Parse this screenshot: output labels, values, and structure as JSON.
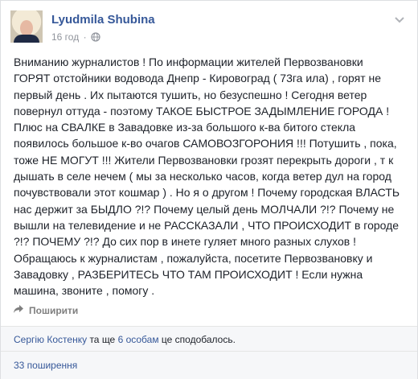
{
  "post": {
    "author": "Lyudmila Shubina",
    "time": "16 год",
    "separator": "·",
    "lines": [
      "Вниманию журналистов ! По информации жителей Первозвановки",
      "ГОРЯТ отстойники водовода Днепр - Кировоград ( 73га ила) , горят не",
      "первый день . Их пытаются тушить, но безуспешно ! Сегодня ветер",
      "повернул оттуда - поэтому ТАКОЕ БЫСТРОЕ ЗАДЫМЛЕНИЕ ГОРОДА !",
      "Плюс на СВАЛКЕ в Завадовке из-за большого к-ва битого стекла",
      "появилось большое к-во очагов САМОВОЗГОРОНИЯ !!! Потушить , пока,",
      "тоже НЕ МОГУТ !!! Жители Первозвановки грозят перекрыть дороги , т к",
      "дышать в селе нечем ( мы за несколько часов, когда ветер дул на город",
      "почувствовали этот кошмар ) . Но я о другом ! Почему городская ВЛАСТЬ",
      "нас держит за БЫДЛО ?!? Почему целый день МОЛЧАЛИ ?!? Почему не",
      "вышли на телевидение и не РАССКАЗАЛИ , ЧТО ПРОИСХОДИТ в городе",
      "?!? ПОЧЕМУ ?!? До сих пор в инете гуляет много разных слухов !",
      "Обращаюсь к журналистам , пожалуйста, посетите Первозвановку и",
      "Завадовку , РАЗБЕРИТЕСЬ ЧТО ТАМ ПРОИСХОДИТ ! Если нужна",
      "машина, звоните , помогу ."
    ]
  },
  "actions": {
    "share_label": "Поширити"
  },
  "likes": {
    "person": "Сергію Костенку",
    "connector": " та ще ",
    "others": "6 особам",
    "suffix": " це сподобалось."
  },
  "shares": {
    "label": "33 поширення"
  },
  "icons": {
    "avatar": "profile-photo",
    "globe": "globe-icon",
    "menu": "chevron-down-icon",
    "share": "share-arrow-icon"
  },
  "colors": {
    "link": "#365899",
    "text": "#1d2129",
    "muted": "#90949c"
  }
}
